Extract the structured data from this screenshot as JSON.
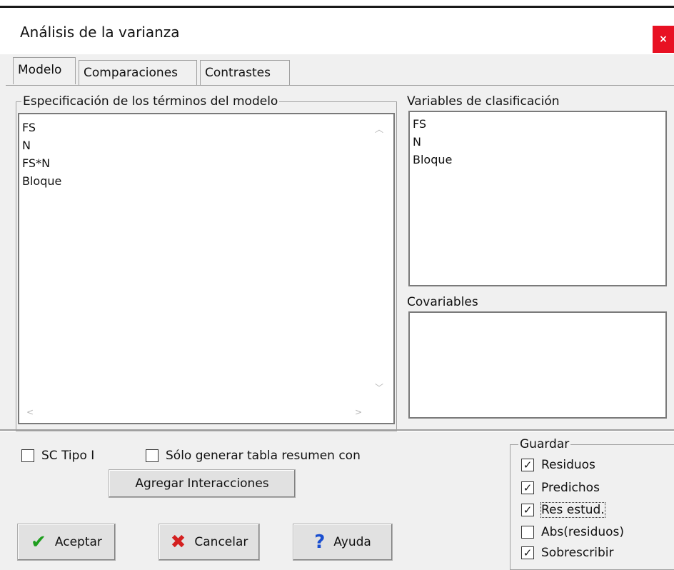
{
  "window": {
    "title": "Análisis de la varianza",
    "close_label": "×"
  },
  "tabs": [
    {
      "label": "Modelo"
    },
    {
      "label": "Comparaciones"
    },
    {
      "label": "Contrastes"
    }
  ],
  "model_terms": {
    "label": "Especificación de los términos del modelo",
    "items": [
      "FS",
      "N",
      "FS*N",
      "Bloque"
    ]
  },
  "classification_vars": {
    "label": "Variables de clasificación",
    "items": [
      "FS",
      "N",
      "Bloque"
    ]
  },
  "covariates": {
    "label": "Covariables"
  },
  "options": {
    "sc_tipo1": {
      "label": "SC Tipo I",
      "checked": false
    },
    "solo_tabla": {
      "label": "Sólo generar tabla resumen con",
      "checked": false
    },
    "add_interactions_label": "Agregar Interacciones"
  },
  "guardar": {
    "label": "Guardar",
    "items": [
      {
        "label": "Residuos",
        "checked": true
      },
      {
        "label": "Predichos",
        "checked": true
      },
      {
        "label": "Res estud.",
        "checked": true
      },
      {
        "label": "Abs(residuos)",
        "checked": false
      },
      {
        "label": "Sobrescribir",
        "checked": true
      }
    ]
  },
  "buttons": {
    "accept": "Aceptar",
    "cancel": "Cancelar",
    "help": "Ayuda"
  },
  "colors": {
    "close": "#e81123",
    "accept_icon": "#1e9e1e",
    "cancel_icon": "#d42020",
    "help_icon": "#1a4fd0"
  }
}
